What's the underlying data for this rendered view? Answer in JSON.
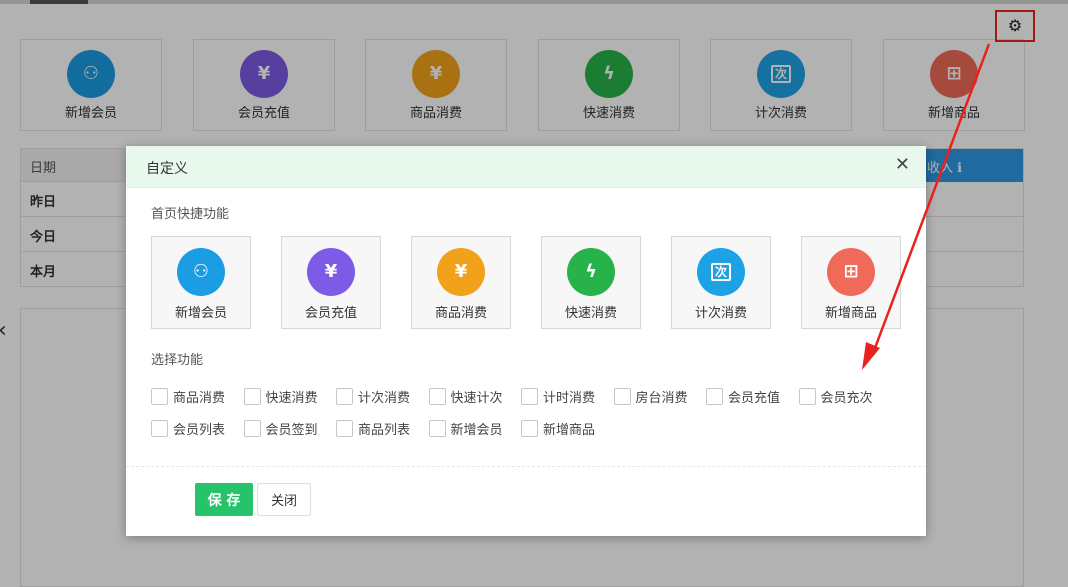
{
  "background": {
    "quick_cards": [
      {
        "label": "新增会员",
        "icon": "add-member-icon",
        "color": "#1a9de2",
        "glyph": "⚇"
      },
      {
        "label": "会员充值",
        "icon": "recharge-icon",
        "color": "#7d5be6",
        "glyph": "¥"
      },
      {
        "label": "商品消费",
        "icon": "product-consume-icon",
        "color": "#f2a21a",
        "glyph": "¥"
      },
      {
        "label": "快速消费",
        "icon": "lightning-icon",
        "color": "#27b34a",
        "glyph": "ϟ"
      },
      {
        "label": "计次消费",
        "icon": "count-consume-icon",
        "color": "#1da2e6",
        "glyph": "次"
      },
      {
        "label": "新增商品",
        "icon": "add-product-icon",
        "color": "#f06a5a",
        "glyph": "⊞"
      }
    ],
    "table": {
      "date_header": "日期",
      "income_header": "收入 ℹ",
      "rows": [
        "昨日",
        "今日",
        "本月"
      ]
    }
  },
  "modal": {
    "title": "自定义",
    "close_glyph": "✕",
    "home_shortcuts_label": "首页快捷功能",
    "shortcut_cards": [
      {
        "label": "新增会员",
        "icon": "add-member-icon",
        "color": "#1a9de2",
        "glyph": "⚇"
      },
      {
        "label": "会员充值",
        "icon": "recharge-icon",
        "color": "#7d5be6",
        "glyph": "¥"
      },
      {
        "label": "商品消费",
        "icon": "product-consume-icon",
        "color": "#f2a21a",
        "glyph": "¥"
      },
      {
        "label": "快速消费",
        "icon": "lightning-icon",
        "color": "#27b34a",
        "glyph": "ϟ"
      },
      {
        "label": "计次消费",
        "icon": "count-consume-icon",
        "color": "#1da2e6",
        "glyph": "次"
      },
      {
        "label": "新增商品",
        "icon": "add-product-icon",
        "color": "#f06a5a",
        "glyph": "⊞"
      }
    ],
    "select_label": "选择功能",
    "options_row1": [
      "商品消费",
      "快速消费",
      "计次消费",
      "快速计次",
      "计时消费",
      "房台消费",
      "会员充值",
      "会员充次"
    ],
    "options_row2": [
      "会员列表",
      "会员签到",
      "商品列表",
      "新增会员",
      "新增商品"
    ],
    "save_label": "保 存",
    "close_label": "关闭"
  }
}
